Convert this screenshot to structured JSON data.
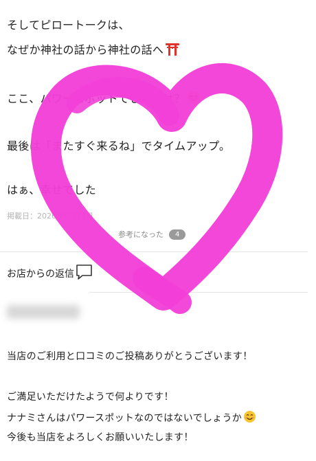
{
  "review": {
    "lines": [
      "そしてピロートークは、",
      "なぜか神社の話から神社の話へ",
      "ここ、パワースポットでしたっけ？",
      "最後は「またすぐ来るね」でタイムアップ。",
      "はぁ、幸せでした"
    ],
    "posted_date": "掲載日：2026年5月13日",
    "helpful_label": "参考になった",
    "helpful_count": "4"
  },
  "reply": {
    "title": "お店からの返信",
    "lines": [
      "当店のご利用と口コミのご投稿ありがとうございます！",
      "ご満足いただけたようで何よりです！",
      "ナナミさんはパワースポットなのではないでしょうか",
      "今後も当店をよろしくお願いいたします！"
    ]
  },
  "icons": {
    "torii": "torii-gate-icon",
    "grin": "grinning-squint-emoji-icon",
    "speech": "speech-bubble-icon",
    "smile": "smiling-face-emoji-icon"
  },
  "colors": {
    "heart_scribble": "#f23fd8",
    "torii_red": "#e0332b",
    "emoji_yellow": "#f7c531"
  }
}
